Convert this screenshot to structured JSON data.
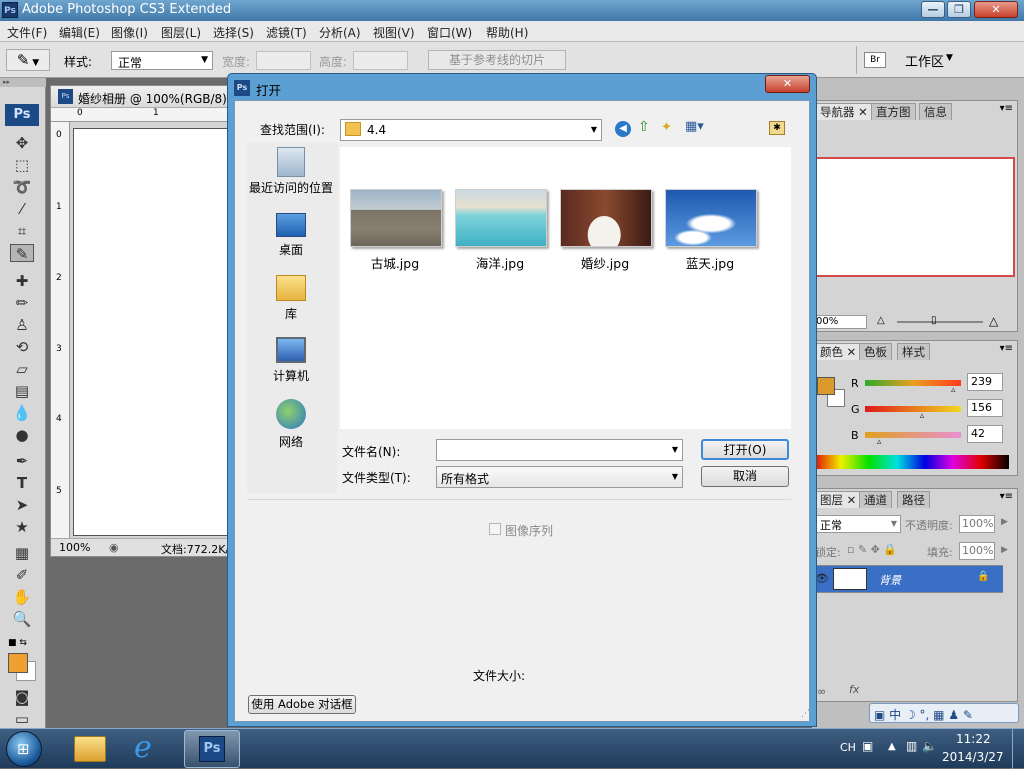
{
  "window": {
    "icon": "Ps",
    "title": "Adobe Photoshop CS3 Extended",
    "min": "—",
    "max": "❐",
    "close": "✕"
  },
  "menu": [
    "文件(F)",
    "编辑(E)",
    "图像(I)",
    "图层(L)",
    "选择(S)",
    "滤镜(T)",
    "分析(A)",
    "视图(V)",
    "窗口(W)",
    "帮助(H)"
  ],
  "options": {
    "style_label": "样式:",
    "style_value": "正常",
    "width_label": "宽度:",
    "height_label": "高度:",
    "slice_button": "基于参考线的切片",
    "workspace": "工作区"
  },
  "document": {
    "tab_title": "婚纱相册 @ 100%(RGB/8)",
    "ruler_top": [
      "0",
      "1"
    ],
    "ruler_left": [
      "0",
      "1",
      "2",
      "3",
      "4",
      "5"
    ],
    "zoom": "100%",
    "doc_info": "文档:772.2K/"
  },
  "toolbox": {
    "ps_logo": "Ps"
  },
  "panels": {
    "navigator": {
      "tabs": [
        "导航器",
        "直方图",
        "信息"
      ],
      "zoom": "00%"
    },
    "color": {
      "tabs": [
        "颜色",
        "色板",
        "样式"
      ],
      "fg_color": "#d99a2b",
      "r_label": "R",
      "g_label": "G",
      "b_label": "B",
      "r": "239",
      "g": "156",
      "b": "42",
      "r_level": 0.937,
      "g_level": 0.612,
      "b_level": 0.165
    },
    "layers": {
      "tabs": [
        "图层",
        "通道",
        "路径"
      ],
      "blend": "正常",
      "opacity_label": "不透明度:",
      "opacity": "100%",
      "lock_label": "锁定:",
      "fill_label": "填充:",
      "fill": "100%",
      "layer_name": "背景"
    }
  },
  "dialog": {
    "icon": "Ps",
    "title": "打开",
    "lookin_label": "查找范围(I):",
    "lookin_value": "4.4",
    "places": [
      {
        "label": "最近访问的位置",
        "icon": "recent-places-icon"
      },
      {
        "label": "桌面",
        "icon": "desktop-icon"
      },
      {
        "label": "库",
        "icon": "library-icon"
      },
      {
        "label": "计算机",
        "icon": "computer-icon"
      },
      {
        "label": "网络",
        "icon": "network-icon"
      }
    ],
    "files": [
      {
        "name": "古城.jpg",
        "icon": "castle-photo-thumbnail"
      },
      {
        "name": "海洋.jpg",
        "icon": "ocean-photo-thumbnail"
      },
      {
        "name": "婚纱.jpg",
        "icon": "wedding-dress-photo-thumbnail"
      },
      {
        "name": "蓝天.jpg",
        "icon": "blue-sky-photo-thumbnail"
      }
    ],
    "filename_label": "文件名(N):",
    "filename_value": "",
    "filetype_label": "文件类型(T):",
    "filetype_value": "所有格式",
    "open_button": "打开(O)",
    "cancel_button": "取消",
    "image_sequence": "图像序列",
    "file_size_label": "文件大小:",
    "adobe_dialog_button": "使用 Adobe 对话框"
  },
  "taskbar": {
    "lang": "CH",
    "time": "11:22",
    "date": "2014/3/27",
    "ps_label": "Ps"
  }
}
